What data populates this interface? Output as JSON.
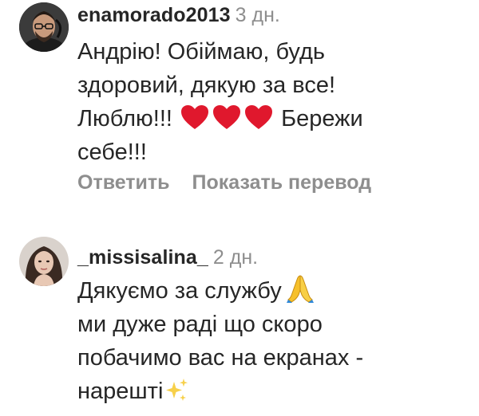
{
  "comments": [
    {
      "username": "enamorado2013",
      "time": "3 дн.",
      "lines": [
        "Андрію! Обіймаю, будь",
        "здоровий, дякую за все!",
        "Люблю!!!",
        "Бережи",
        "себе!!!"
      ],
      "emoji": [
        "red-heart",
        "red-heart",
        "red-heart"
      ],
      "actions": {
        "reply": "Ответить",
        "translate": "Показать перевод"
      }
    },
    {
      "username": "_missisalina_",
      "time": "2 дн.",
      "lines": [
        "Дякуємо за службу",
        "ми дуже раді що скоро",
        "побачимо вас на екранах -",
        "нарешті"
      ],
      "emoji": [
        "folded-hands",
        "sparkles"
      ]
    }
  ],
  "colors": {
    "text": "#262626",
    "muted": "#8e8e8e",
    "heart": "#e0182d",
    "pray": "#f6c02b"
  }
}
